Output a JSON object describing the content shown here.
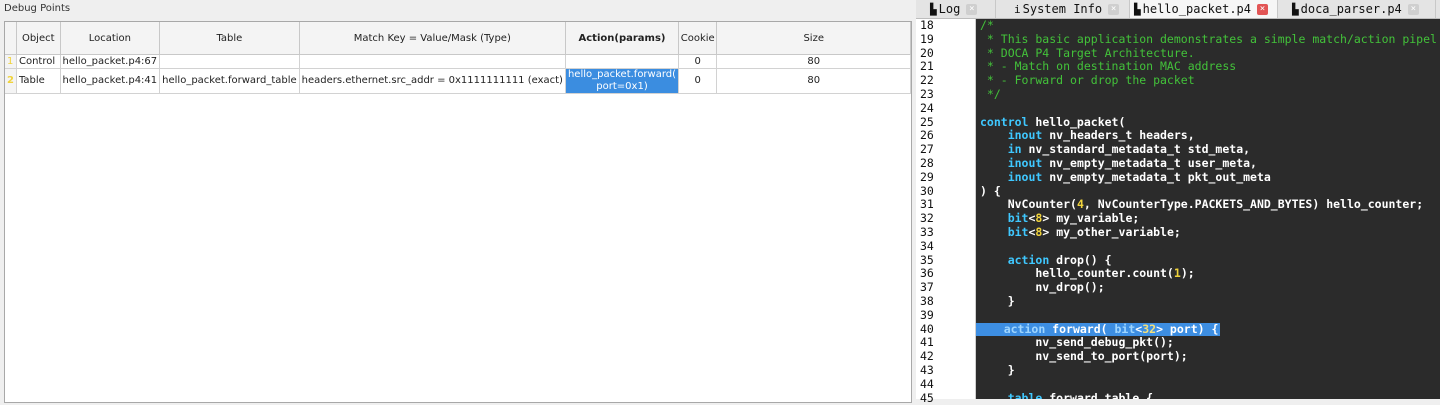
{
  "debug_panel": {
    "title": "Debug Points",
    "columns": [
      "",
      "Object",
      "Location",
      "Table",
      "Match Key = Value/Mask (Type)",
      "Action(params)",
      "Cookie",
      "Size"
    ],
    "rows": [
      {
        "index": "1",
        "object": "Control",
        "location": "hello_packet.p4:67",
        "table": "",
        "match_key": "",
        "action": "",
        "cookie": "0",
        "size": "80"
      },
      {
        "index": "2",
        "object": "Table",
        "location": "hello_packet.p4:41",
        "table": "hello_packet.forward_table",
        "match_key": "headers.ethernet.src_addr = 0x1111111111 (exact)",
        "action": "hello_packet.forward( port=0x1)",
        "cookie": "0",
        "size": "80"
      }
    ],
    "selection_color": "#3b8de0"
  },
  "editor": {
    "tabs": [
      {
        "icon": "document-icon",
        "label": "Log",
        "active": false
      },
      {
        "icon": "info-icon",
        "label": "System Info",
        "active": false
      },
      {
        "icon": "document-icon",
        "label": "hello_packet.p4",
        "active": true
      },
      {
        "icon": "document-icon",
        "label": "doca_parser.p4",
        "active": false
      }
    ],
    "colors": {
      "background": "#2b2b2b",
      "comment": "#43c23a",
      "keyword": "#3fc8ff",
      "number": "#f0d33c",
      "highlight": "#3d8ee2"
    },
    "lines": [
      {
        "n": "18",
        "text": "/*"
      },
      {
        "n": "19",
        "text": " * This basic application demonstrates a simple match/action pipel"
      },
      {
        "n": "20",
        "text": " * DOCA P4 Target Architecture."
      },
      {
        "n": "21",
        "text": " * - Match on destination MAC address"
      },
      {
        "n": "22",
        "text": " * - Forward or drop the packet"
      },
      {
        "n": "23",
        "text": " */"
      },
      {
        "n": "24",
        "text": ""
      },
      {
        "n": "25",
        "text": "control hello_packet("
      },
      {
        "n": "26",
        "text": "    inout nv_headers_t headers,"
      },
      {
        "n": "27",
        "text": "    in nv_standard_metadata_t std_meta,"
      },
      {
        "n": "28",
        "text": "    inout nv_empty_metadata_t user_meta,"
      },
      {
        "n": "29",
        "text": "    inout nv_empty_metadata_t pkt_out_meta"
      },
      {
        "n": "30",
        "text": ") {"
      },
      {
        "n": "31",
        "text": "    NvCounter(4, NvCounterType.PACKETS_AND_BYTES) hello_counter;"
      },
      {
        "n": "32",
        "text": "    bit<8> my_variable;"
      },
      {
        "n": "33",
        "text": "    bit<8> my_other_variable;"
      },
      {
        "n": "34",
        "text": ""
      },
      {
        "n": "35",
        "text": "    action drop() {"
      },
      {
        "n": "36",
        "text": "        hello_counter.count(1);"
      },
      {
        "n": "37",
        "text": "        nv_drop();"
      },
      {
        "n": "38",
        "text": "    }"
      },
      {
        "n": "39",
        "text": ""
      },
      {
        "n": "40",
        "text": "    action forward( bit<32> port) {"
      },
      {
        "n": "41",
        "text": "        nv_send_debug_pkt();"
      },
      {
        "n": "42",
        "text": "        nv_send_to_port(port);"
      },
      {
        "n": "43",
        "text": "    }"
      },
      {
        "n": "44",
        "text": ""
      },
      {
        "n": "45",
        "text": "    table forward_table {"
      }
    ],
    "highlighted_line": "40"
  }
}
